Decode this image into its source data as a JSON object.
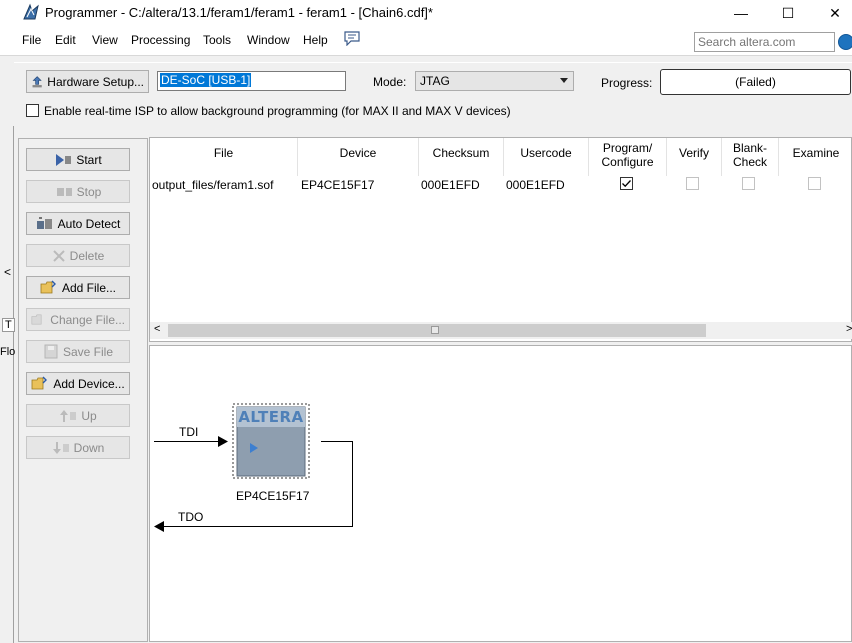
{
  "window": {
    "title": "Programmer - C:/altera/13.1/feram1/feram1 - feram1 - [Chain6.cdf]*",
    "controls": {
      "minimize": "—",
      "maximize": "☐",
      "close": "✕"
    }
  },
  "menu": [
    "File",
    "Edit",
    "View",
    "Processing",
    "Tools",
    "Window",
    "Help"
  ],
  "search": {
    "placeholder": "Search altera.com"
  },
  "hardware": {
    "setup_label": "Hardware Setup...",
    "hardware_value": "DE-SoC [USB-1]",
    "mode_label": "Mode:",
    "mode_value": "JTAG",
    "progress_label": "Progress:",
    "progress_value": "(Failed)",
    "isp_label": "Enable real-time ISP to allow background programming (for MAX II and MAX V devices)"
  },
  "side_buttons": [
    {
      "label": "Start",
      "enabled": true,
      "icon": "play-icon"
    },
    {
      "label": "Stop",
      "enabled": false,
      "icon": "stop-icon"
    },
    {
      "label": "Auto Detect",
      "enabled": true,
      "icon": "auto-detect-icon"
    },
    {
      "label": "Delete",
      "enabled": false,
      "icon": "delete-icon"
    },
    {
      "label": "Add File...",
      "enabled": true,
      "icon": "folder-icon"
    },
    {
      "label": "Change File...",
      "enabled": false,
      "icon": "change-file-icon"
    },
    {
      "label": "Save File",
      "enabled": false,
      "icon": "save-icon"
    },
    {
      "label": "Add Device...",
      "enabled": true,
      "icon": "folder-icon"
    },
    {
      "label": "Up",
      "enabled": false,
      "icon": "up-icon"
    },
    {
      "label": "Down",
      "enabled": false,
      "icon": "down-icon"
    }
  ],
  "table": {
    "columns": [
      "File",
      "Device",
      "Checksum",
      "Usercode",
      "Program/ Configure",
      "Verify",
      "Blank- Check",
      "Examine"
    ],
    "rows": [
      {
        "file": "output_files/feram1.sof",
        "device": "EP4CE15F17",
        "checksum": "000E1EFD",
        "usercode": "000E1EFD",
        "program": true,
        "verify": false,
        "blank_check": false,
        "examine": false
      }
    ]
  },
  "chain": {
    "tdi": "TDI",
    "tdo": "TDO",
    "device": "EP4CE15F17",
    "chip_logo": "ALTERA"
  },
  "left_strip": [
    "<",
    "T",
    "Flo"
  ],
  "colors": {
    "selection": "#0078d7",
    "chip": "#8a9aab",
    "search_go": "#1e73be"
  }
}
